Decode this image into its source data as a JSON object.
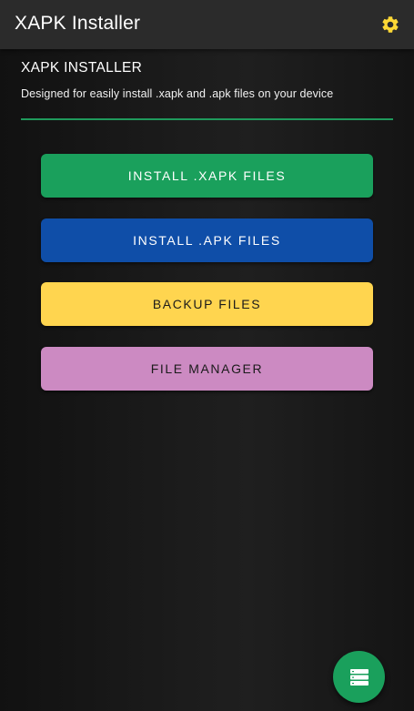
{
  "app_bar": {
    "title": "XAPK Installer",
    "settings_icon": "gear-icon",
    "settings_color": "#fdd835"
  },
  "header": {
    "title": "XAPK INSTALLER",
    "description": "Designed for easily install .xapk and .apk files on your device",
    "divider_color": "#1f9a5c"
  },
  "actions": [
    {
      "label": "INSTALL .XAPK FILES",
      "color": "#1aa05c"
    },
    {
      "label": "INSTALL .APK FILES",
      "color": "#0f4ea8"
    },
    {
      "label": "BACKUP FILES",
      "color": "#ffd54f"
    },
    {
      "label": "FILE MANAGER",
      "color": "#cc8ac2"
    }
  ],
  "fab": {
    "icon": "list-icon",
    "color": "#1aa05c"
  }
}
